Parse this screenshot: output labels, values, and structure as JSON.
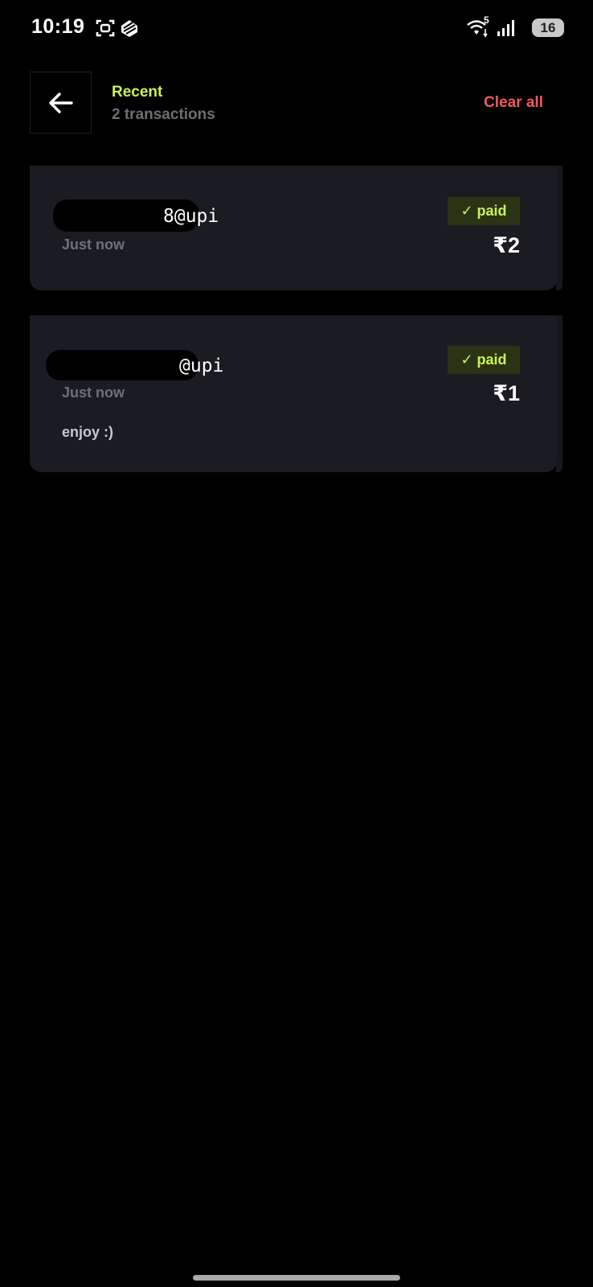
{
  "status_bar": {
    "time": "10:19",
    "network_badge": "5",
    "battery": "16"
  },
  "header": {
    "title": "Recent",
    "subtitle": "2 transactions",
    "clear_all": "Clear all"
  },
  "transactions": [
    {
      "upi_suffix": "8@upi",
      "time": "Just now",
      "status": "paid",
      "amount": "₹2",
      "note": ""
    },
    {
      "upi_suffix": "@upi",
      "time": "Just now",
      "status": "paid",
      "amount": "₹1",
      "note": "enjoy :)"
    }
  ],
  "colors": {
    "accent": "#c8f25c",
    "danger": "#ef5a5a",
    "card": "#1b1c21",
    "background": "#000000"
  }
}
